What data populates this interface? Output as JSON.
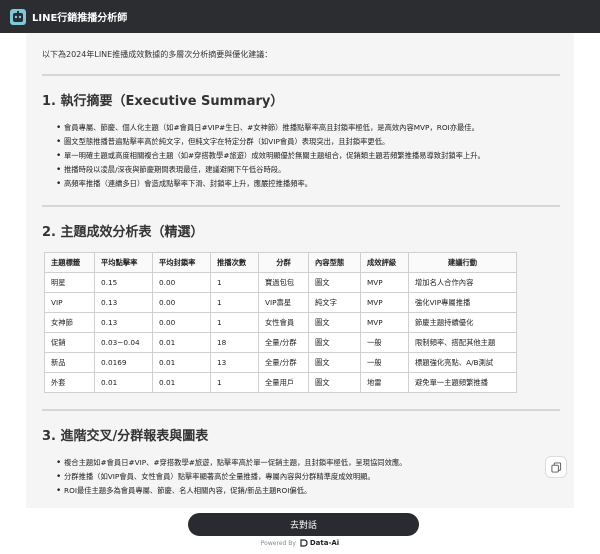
{
  "header": {
    "app_title": "LINE行銷推播分析師"
  },
  "intro": "以下為2024年LINE推播成效數據的多層次分析摘要與優化建議：",
  "section1": {
    "title": "1. 執行摘要（Executive Summary）",
    "bullets": [
      "會員專屬、節慶、個人化主題（如#會員日#VIP#生日、#女神節）推播點擊率高且封鎖率極低，是高效內容MVP，ROI亦最佳。",
      "圖文型態推播普遍點擊率高於純文字，但純文字在特定分群（如VIP會員）表現突出，且封鎖率更低。",
      "單一明確主題或高度相關複合主題（如#穿搭教學#旅遊）成效明顯優於無關主題組合，促銷類主題若頻繁推播易導致封鎖率上升。",
      "推播時段以凌晨/深夜與節慶期間表現最佳，建議避開下午低谷時段。",
      "高頻率推播（連續多日）會造成點擊率下滑、封鎖率上升，應嚴控推播頻率。"
    ]
  },
  "section2": {
    "title": "2. 主題成效分析表（精選）",
    "columns": [
      "主題標籤",
      "平均點擊率",
      "平均封鎖率",
      "推播次數",
      "分群",
      "內容型態",
      "成效評級",
      "建議行動"
    ],
    "rows": [
      [
        "明星",
        "0.15",
        "0.00",
        "1",
        "寶過包包",
        "圖文",
        "MVP",
        "增加名人合作內容"
      ],
      [
        "VIP",
        "0.13",
        "0.00",
        "1",
        "VIP壽星",
        "純文字",
        "MVP",
        "強化VIP專屬推播"
      ],
      [
        "女神節",
        "0.13",
        "0.00",
        "1",
        "女性會員",
        "圖文",
        "MVP",
        "節慶主題持續優化"
      ],
      [
        "促銷",
        "0.03~0.04",
        "0.01",
        "18",
        "全量/分群",
        "圖文",
        "一般",
        "限制頻率、搭配其他主題"
      ],
      [
        "新品",
        "0.0169",
        "0.01",
        "13",
        "全量/分群",
        "圖文",
        "一般",
        "標題強化亮點、A/B測試"
      ],
      [
        "外套",
        "0.01",
        "0.01",
        "1",
        "全量用戶",
        "圖文",
        "地雷",
        "避免單一主題頻繁推播"
      ]
    ]
  },
  "section3": {
    "title": "3. 進階交叉/分群報表與圖表",
    "bullets": [
      "複合主題如#會員日#VIP、#穿搭教學#旅遊，點擊率高於單一促銷主題，且封鎖率極低，呈現協同效應。",
      "分群推播（如VIP會員、女性會員）點擊率顯著高於全量推播，專屬內容與分群精準度成效明顯。",
      "ROI最佳主題多為會員專屬、節慶、名人相關內容，促銷/新品主題ROI偏低。"
    ]
  },
  "cta_label": "去對話",
  "footer": {
    "powered_by": "Powered By",
    "brand": "Data-Ai"
  }
}
